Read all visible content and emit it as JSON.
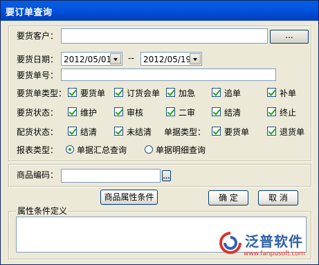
{
  "window": {
    "title": "要订单查询"
  },
  "filters": {
    "customer": {
      "label": "要货客户：",
      "value": "",
      "button": "..."
    },
    "date": {
      "label": "要货日期：",
      "from": "2012/05/01",
      "sep": "--",
      "to": "2012/05/19"
    },
    "order_no": {
      "label": "要货单号：",
      "value": ""
    },
    "order_type": {
      "label": "要货单类型：",
      "options": [
        {
          "label": "要货单",
          "checked": true
        },
        {
          "label": "订货会单",
          "checked": true
        },
        {
          "label": "加急",
          "checked": true
        },
        {
          "label": "追单",
          "checked": true
        },
        {
          "label": "补单",
          "checked": true
        }
      ]
    },
    "order_status": {
      "label": "要货状态：",
      "options": [
        {
          "label": "维护",
          "checked": true
        },
        {
          "label": "审核",
          "checked": true
        },
        {
          "label": "二审",
          "checked": true
        },
        {
          "label": "结清",
          "checked": true
        },
        {
          "label": "终止",
          "checked": true
        }
      ]
    },
    "dist_status": {
      "label": "配货状态：",
      "options": [
        {
          "label": "结清",
          "checked": true
        },
        {
          "label": "未结清",
          "checked": true
        }
      ]
    },
    "bill_type": {
      "label": "单据类型：",
      "options": [
        {
          "label": "要货单",
          "checked": true
        },
        {
          "label": "退货单",
          "checked": true
        }
      ]
    },
    "report_type": {
      "label": "报表类型：",
      "options": [
        {
          "label": "单据汇总查询",
          "selected": true
        },
        {
          "label": "单据明细查询",
          "selected": false
        }
      ]
    }
  },
  "product": {
    "label": "商品编码：",
    "value": "",
    "button": "..."
  },
  "buttons": {
    "attr": "商品属性条件",
    "ok": "确 定",
    "cancel": "取 消"
  },
  "attr_group": {
    "legend": "属性条件定义",
    "value": ""
  },
  "watermark": {
    "brand": "泛普软件",
    "url": "www.fanpusoft.com"
  },
  "colors": {
    "title_bar": "#0054e3",
    "dialog_bg": "#ece9d8",
    "check": "#21a121"
  }
}
